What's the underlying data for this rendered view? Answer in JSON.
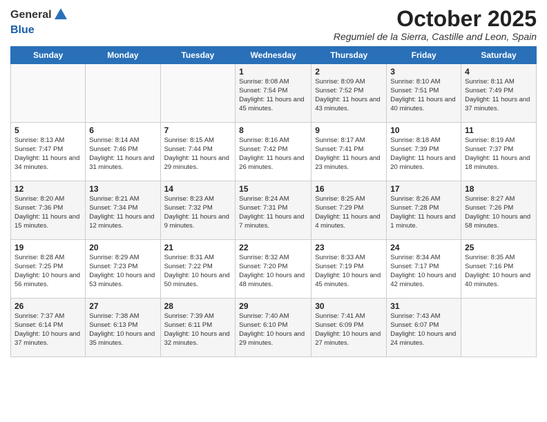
{
  "header": {
    "logo_line1": "General",
    "logo_line2": "Blue",
    "month": "October 2025",
    "location": "Regumiel de la Sierra, Castille and Leon, Spain"
  },
  "weekdays": [
    "Sunday",
    "Monday",
    "Tuesday",
    "Wednesday",
    "Thursday",
    "Friday",
    "Saturday"
  ],
  "weeks": [
    [
      {
        "day": "",
        "info": ""
      },
      {
        "day": "",
        "info": ""
      },
      {
        "day": "",
        "info": ""
      },
      {
        "day": "1",
        "info": "Sunrise: 8:08 AM\nSunset: 7:54 PM\nDaylight: 11 hours and 45 minutes."
      },
      {
        "day": "2",
        "info": "Sunrise: 8:09 AM\nSunset: 7:52 PM\nDaylight: 11 hours and 43 minutes."
      },
      {
        "day": "3",
        "info": "Sunrise: 8:10 AM\nSunset: 7:51 PM\nDaylight: 11 hours and 40 minutes."
      },
      {
        "day": "4",
        "info": "Sunrise: 8:11 AM\nSunset: 7:49 PM\nDaylight: 11 hours and 37 minutes."
      }
    ],
    [
      {
        "day": "5",
        "info": "Sunrise: 8:13 AM\nSunset: 7:47 PM\nDaylight: 11 hours and 34 minutes."
      },
      {
        "day": "6",
        "info": "Sunrise: 8:14 AM\nSunset: 7:46 PM\nDaylight: 11 hours and 31 minutes."
      },
      {
        "day": "7",
        "info": "Sunrise: 8:15 AM\nSunset: 7:44 PM\nDaylight: 11 hours and 29 minutes."
      },
      {
        "day": "8",
        "info": "Sunrise: 8:16 AM\nSunset: 7:42 PM\nDaylight: 11 hours and 26 minutes."
      },
      {
        "day": "9",
        "info": "Sunrise: 8:17 AM\nSunset: 7:41 PM\nDaylight: 11 hours and 23 minutes."
      },
      {
        "day": "10",
        "info": "Sunrise: 8:18 AM\nSunset: 7:39 PM\nDaylight: 11 hours and 20 minutes."
      },
      {
        "day": "11",
        "info": "Sunrise: 8:19 AM\nSunset: 7:37 PM\nDaylight: 11 hours and 18 minutes."
      }
    ],
    [
      {
        "day": "12",
        "info": "Sunrise: 8:20 AM\nSunset: 7:36 PM\nDaylight: 11 hours and 15 minutes."
      },
      {
        "day": "13",
        "info": "Sunrise: 8:21 AM\nSunset: 7:34 PM\nDaylight: 11 hours and 12 minutes."
      },
      {
        "day": "14",
        "info": "Sunrise: 8:23 AM\nSunset: 7:32 PM\nDaylight: 11 hours and 9 minutes."
      },
      {
        "day": "15",
        "info": "Sunrise: 8:24 AM\nSunset: 7:31 PM\nDaylight: 11 hours and 7 minutes."
      },
      {
        "day": "16",
        "info": "Sunrise: 8:25 AM\nSunset: 7:29 PM\nDaylight: 11 hours and 4 minutes."
      },
      {
        "day": "17",
        "info": "Sunrise: 8:26 AM\nSunset: 7:28 PM\nDaylight: 11 hours and 1 minute."
      },
      {
        "day": "18",
        "info": "Sunrise: 8:27 AM\nSunset: 7:26 PM\nDaylight: 10 hours and 58 minutes."
      }
    ],
    [
      {
        "day": "19",
        "info": "Sunrise: 8:28 AM\nSunset: 7:25 PM\nDaylight: 10 hours and 56 minutes."
      },
      {
        "day": "20",
        "info": "Sunrise: 8:29 AM\nSunset: 7:23 PM\nDaylight: 10 hours and 53 minutes."
      },
      {
        "day": "21",
        "info": "Sunrise: 8:31 AM\nSunset: 7:22 PM\nDaylight: 10 hours and 50 minutes."
      },
      {
        "day": "22",
        "info": "Sunrise: 8:32 AM\nSunset: 7:20 PM\nDaylight: 10 hours and 48 minutes."
      },
      {
        "day": "23",
        "info": "Sunrise: 8:33 AM\nSunset: 7:19 PM\nDaylight: 10 hours and 45 minutes."
      },
      {
        "day": "24",
        "info": "Sunrise: 8:34 AM\nSunset: 7:17 PM\nDaylight: 10 hours and 42 minutes."
      },
      {
        "day": "25",
        "info": "Sunrise: 8:35 AM\nSunset: 7:16 PM\nDaylight: 10 hours and 40 minutes."
      }
    ],
    [
      {
        "day": "26",
        "info": "Sunrise: 7:37 AM\nSunset: 6:14 PM\nDaylight: 10 hours and 37 minutes."
      },
      {
        "day": "27",
        "info": "Sunrise: 7:38 AM\nSunset: 6:13 PM\nDaylight: 10 hours and 35 minutes."
      },
      {
        "day": "28",
        "info": "Sunrise: 7:39 AM\nSunset: 6:11 PM\nDaylight: 10 hours and 32 minutes."
      },
      {
        "day": "29",
        "info": "Sunrise: 7:40 AM\nSunset: 6:10 PM\nDaylight: 10 hours and 29 minutes."
      },
      {
        "day": "30",
        "info": "Sunrise: 7:41 AM\nSunset: 6:09 PM\nDaylight: 10 hours and 27 minutes."
      },
      {
        "day": "31",
        "info": "Sunrise: 7:43 AM\nSunset: 6:07 PM\nDaylight: 10 hours and 24 minutes."
      },
      {
        "day": "",
        "info": ""
      }
    ]
  ]
}
